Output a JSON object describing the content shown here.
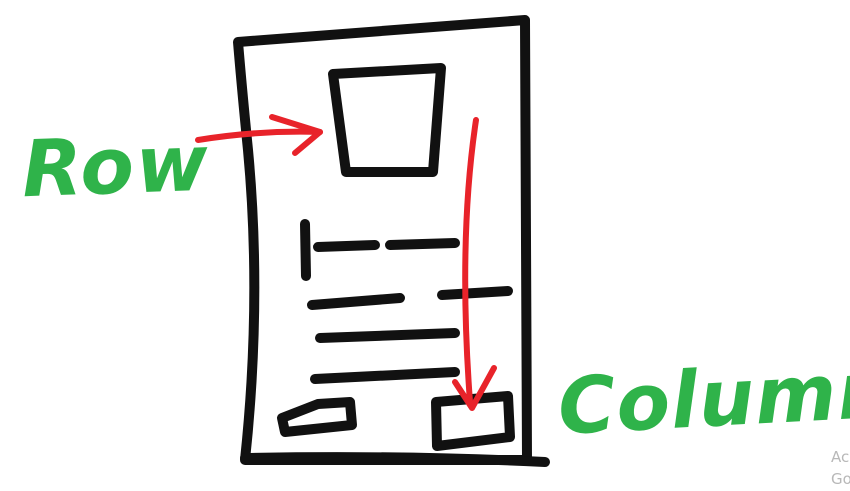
{
  "labels": {
    "row": "Row",
    "column": "Column"
  },
  "watermark": {
    "line1": "Ac",
    "line2": "Go"
  },
  "colors": {
    "outline": "#111111",
    "arrow": "#e8232a",
    "label": "#2fb34a",
    "watermark": "#b8b8b8"
  }
}
